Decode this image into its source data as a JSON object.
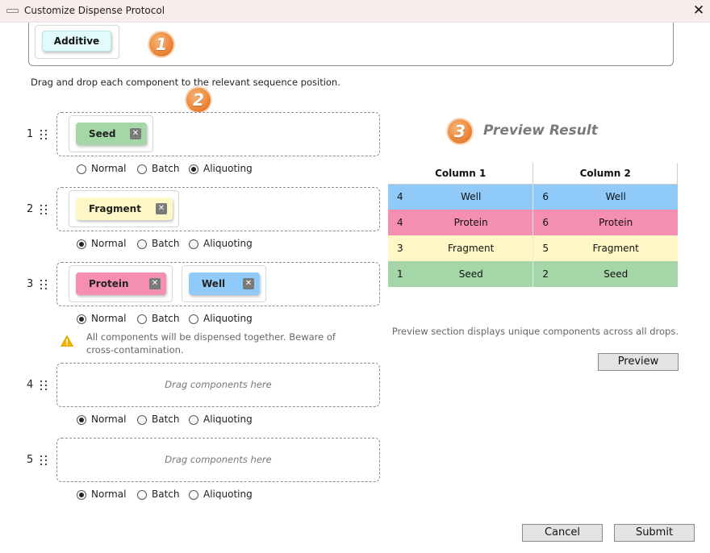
{
  "window": {
    "title": "Customize Dispense Protocol"
  },
  "palette": {
    "components": [
      "Additive"
    ],
    "additive_color": "#e1fbfc",
    "step_badge": "1"
  },
  "instruction": "Drag and drop each component to the relevant sequence position.",
  "sequence_badge": "2",
  "radio_options": [
    "Normal",
    "Batch",
    "Aliquoting"
  ],
  "drop_placeholder": "Drag components here",
  "sequence": [
    {
      "index": "1",
      "components": [
        {
          "label": "Seed",
          "color": "#a5d6a7"
        }
      ],
      "mode": "Aliquoting"
    },
    {
      "index": "2",
      "components": [
        {
          "label": "Fragment",
          "color": "#fff8c6"
        }
      ],
      "mode": "Normal"
    },
    {
      "index": "3",
      "components": [
        {
          "label": "Protein",
          "color": "#f48fb1"
        },
        {
          "label": "Well",
          "color": "#90caf9"
        }
      ],
      "mode": "Normal",
      "warning": "All components will be dispensed together. Beware of cross-contamination."
    },
    {
      "index": "4",
      "components": [],
      "mode": "Normal"
    },
    {
      "index": "5",
      "components": [],
      "mode": "Normal"
    }
  ],
  "preview": {
    "badge": "3",
    "title": "Preview Result",
    "columns": [
      "Column 1",
      "Column 2"
    ],
    "rows": [
      {
        "c1_num": "4",
        "c1_label": "Well",
        "c2_num": "6",
        "c2_label": "Well",
        "color": "#90caf9"
      },
      {
        "c1_num": "4",
        "c1_label": "Protein",
        "c2_num": "6",
        "c2_label": "Protein",
        "color": "#f48fb1"
      },
      {
        "c1_num": "3",
        "c1_label": "Fragment",
        "c2_num": "5",
        "c2_label": "Fragment",
        "color": "#fff8c6"
      },
      {
        "c1_num": "1",
        "c1_label": "Seed",
        "c2_num": "2",
        "c2_label": "Seed",
        "color": "#a5d6a7"
      }
    ],
    "note": "Preview section displays unique components across all drops.",
    "button": "Preview"
  },
  "footer": {
    "cancel": "Cancel",
    "submit": "Submit"
  }
}
